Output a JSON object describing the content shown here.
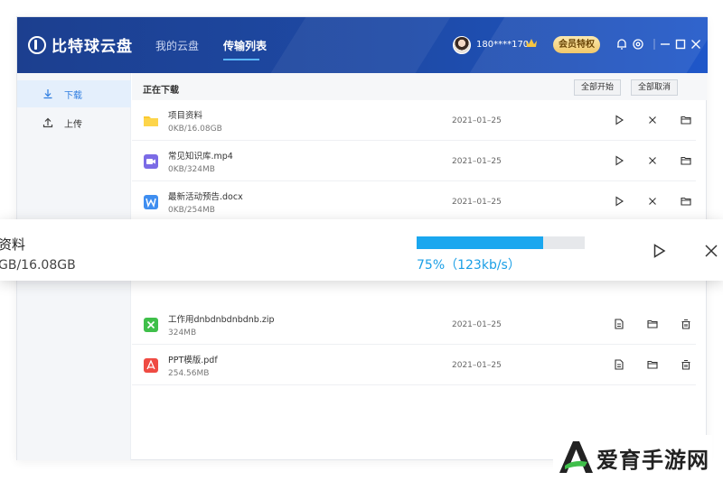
{
  "header": {
    "logo_text": "比特球云盘",
    "tabs": [
      {
        "label": "我的云盘",
        "active": false
      },
      {
        "label": "传输列表",
        "active": true
      }
    ],
    "user_id": "180****170",
    "vip_label": "会员特权",
    "accent_color": "#1e4aa6"
  },
  "sidebar": {
    "items": [
      {
        "label": "下载",
        "icon": "download-icon",
        "active": true
      },
      {
        "label": "上传",
        "icon": "upload-icon",
        "active": false
      }
    ]
  },
  "downloading": {
    "title": "正在下载",
    "start_all_label": "全部开始",
    "cancel_all_label": "全部取消",
    "rows": [
      {
        "name": "项目资料",
        "size": "0KB/16.08GB",
        "date": "2021–01–25",
        "type": "folder-icon"
      },
      {
        "name": "常见知识库.mp4",
        "size": "0KB/324MB",
        "date": "2021–01–25",
        "type": "video-file-icon"
      },
      {
        "name": "最新活动预告.docx",
        "size": "0KB/254MB",
        "date": "2021–01–25",
        "type": "word-file-icon"
      }
    ]
  },
  "completed": {
    "rows": [
      {
        "name": "工作用dnbdnbdnbdnb.zip",
        "size": "324MB",
        "date": "2021–01–25",
        "type": "zip-file-icon"
      },
      {
        "name": "PPT模版.pdf",
        "size": "254.56MB",
        "date": "2021–01–25",
        "type": "pdf-file-icon"
      }
    ]
  },
  "floating_card": {
    "name": "资料",
    "size": "GB/16.08GB",
    "progress_percent": 75,
    "status_text": "75%（123kb/s）",
    "progress_color": "#1aa7ef"
  },
  "watermark": {
    "text": "爱育手游网"
  }
}
